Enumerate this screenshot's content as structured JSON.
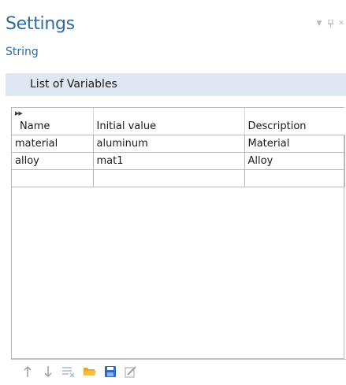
{
  "header": {
    "title": "Settings",
    "subtitle": "String"
  },
  "section": {
    "title": "List of Variables"
  },
  "table": {
    "columns": [
      "Name",
      "Initial value",
      "Description"
    ],
    "rows": [
      [
        "material",
        "aluminum",
        "Material"
      ],
      [
        "alloy",
        "mat1",
        "Alloy"
      ],
      [
        "",
        "",
        ""
      ]
    ]
  },
  "toolbar": {
    "icons": [
      "move-up-icon",
      "move-down-icon",
      "clear-table-icon",
      "load-from-file-icon",
      "save-to-file-icon",
      "edit-icon"
    ]
  },
  "colors": {
    "accent": "#2b6aa6",
    "section_bg": "#dfe8f2",
    "folder": "#e8a827",
    "save": "#2d6cc0"
  }
}
